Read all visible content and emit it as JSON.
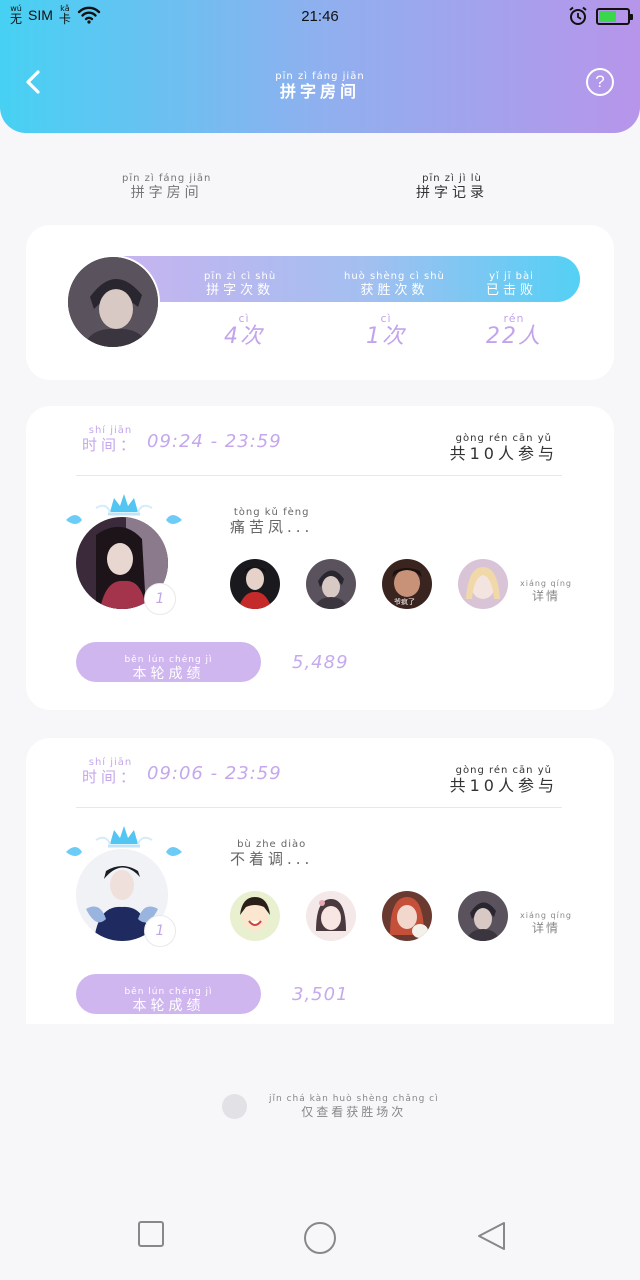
{
  "status_bar": {
    "no_sim_pinyin": "wú",
    "no_sim": "无",
    "sim": "SIM",
    "card_pinyin": "kǎ",
    "card": "卡",
    "time": "21:46",
    "battery_level": 0.6,
    "battery_color": "#3ad64b"
  },
  "header": {
    "title_pinyin": "pīn zì fáng jiān",
    "title": "拼字房间",
    "back_icon": "chevron-left-icon",
    "help_label": "?"
  },
  "tabs": [
    {
      "pinyin": "pīn zì fáng jiān",
      "label": "拼字房间"
    },
    {
      "pinyin": "pīn zì jì lù",
      "label": "拼字记录"
    }
  ],
  "stats": {
    "items": [
      {
        "label_pinyin": "pīn zì cì shù",
        "label": "拼字次数",
        "value_pinyin": "cì",
        "value": "4次"
      },
      {
        "label_pinyin": "huò shèng cì shù",
        "label": "获胜次数",
        "value_pinyin": "cì",
        "value": "1次"
      },
      {
        "label_pinyin": "yǐ jī bài",
        "label": "已击败",
        "value_pinyin": "rén",
        "value": "22人"
      }
    ]
  },
  "matches": [
    {
      "time_pinyin": "shí jiān",
      "time_label": "时间：",
      "time_range": "09:24 - 23:59",
      "participants_pinyin": "gòng  rén cān yǔ",
      "participants": "共10人参与",
      "song_pinyin": "tòng kǔ fèng",
      "song": "痛苦凤...",
      "rank": "1",
      "player_caption": "爷疯了",
      "detail_pinyin": "xiáng qíng",
      "detail": "详情",
      "score_label_pinyin": "běn lún chéng jì",
      "score_label": "本轮成绩",
      "score": "5,489"
    },
    {
      "time_pinyin": "shí jiān",
      "time_label": "时间：",
      "time_range": "09:06 - 23:59",
      "participants_pinyin": "gòng  rén cān yǔ",
      "participants": "共10人参与",
      "song_pinyin": "bù zhe diào",
      "song": "不着调...",
      "rank": "1",
      "detail_pinyin": "xiáng qíng",
      "detail": "详情",
      "score_label_pinyin": "běn lún chéng jì",
      "score_label": "本轮成绩",
      "score": "3,501"
    }
  ],
  "filter": {
    "pinyin": "jǐn chá kàn huò shèng chǎng cì",
    "label": "仅查看获胜场次"
  },
  "colors": {
    "header_start": "#46d1f3",
    "header_end": "#b795ea",
    "accent": "#c5a7ee"
  }
}
